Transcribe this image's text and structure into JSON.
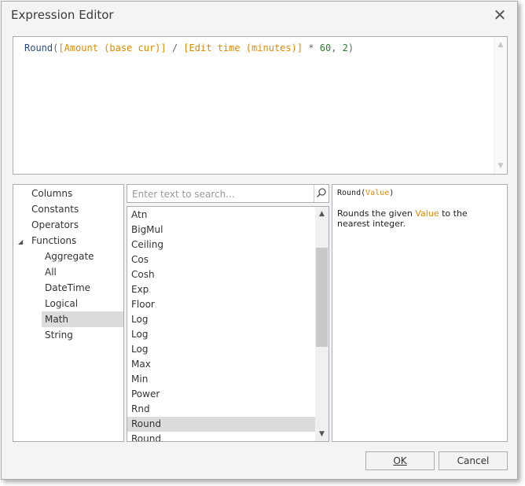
{
  "window": {
    "title": "Expression Editor",
    "close_glyph": "✕"
  },
  "editor": {
    "tokens": [
      {
        "text": "Round",
        "kind": "fn"
      },
      {
        "text": "(",
        "kind": "op"
      },
      {
        "text": "[Amount (base cur)]",
        "kind": "field"
      },
      {
        "text": " / ",
        "kind": "op"
      },
      {
        "text": "[Edit time (minutes)]",
        "kind": "field"
      },
      {
        "text": " * ",
        "kind": "op"
      },
      {
        "text": "60",
        "kind": "num"
      },
      {
        "text": ", ",
        "kind": "op"
      },
      {
        "text": "2",
        "kind": "num"
      },
      {
        "text": ")",
        "kind": "op"
      }
    ]
  },
  "categories": {
    "top": [
      "Columns",
      "Constants",
      "Operators",
      "Functions"
    ],
    "sub": [
      "Aggregate",
      "All",
      "DateTime",
      "Logical",
      "Math",
      "String"
    ],
    "selected": "Math",
    "expander_glyph": "◢"
  },
  "search": {
    "placeholder": "Enter text to search..."
  },
  "functions": {
    "items": [
      "Atn",
      "BigMul",
      "Ceiling",
      "Cos",
      "Cosh",
      "Exp",
      "Floor",
      "Log",
      "Log",
      "Log",
      "Max",
      "Min",
      "Power",
      "Rnd",
      "Round",
      "Round"
    ],
    "selected_index": 14
  },
  "description": {
    "sig_name": "Round(",
    "sig_param": "Value",
    "sig_end": ")",
    "text_before": "Rounds the given ",
    "text_param": "Value",
    "text_after": " to the nearest integer."
  },
  "buttons": {
    "ok_label": "OK",
    "cancel_label": "Cancel"
  },
  "colors": {
    "field": "#e08a00",
    "function": "#2a4b8d",
    "number": "#2e7d32",
    "selection": "#dcdcdc"
  }
}
